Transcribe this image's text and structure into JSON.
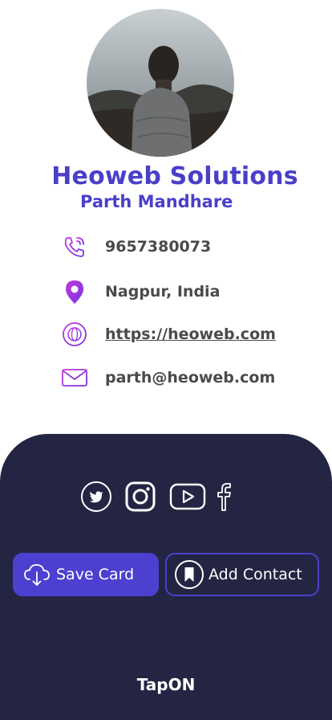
{
  "profile": {
    "company": "Heoweb Solutions",
    "name": "Parth Mandhare"
  },
  "contacts": {
    "phone": "9657380073",
    "location": "Nagpur, India",
    "website": "https://heoweb.com",
    "email": "parth@heoweb.com"
  },
  "icons": {
    "phone": "phone-icon",
    "location": "location-pin-icon",
    "website": "globe-icon",
    "email": "envelope-icon",
    "twitter": "twitter-icon",
    "instagram": "instagram-icon",
    "youtube": "youtube-icon",
    "facebook": "facebook-icon",
    "save": "cloud-download-icon",
    "add": "bookmark-icon"
  },
  "actions": {
    "save_label": "Save Card",
    "add_label": "Add Contact"
  },
  "footer": {
    "brand": "TapON"
  },
  "colors": {
    "accent": "#4a3fc9",
    "icon_gradient_start": "#c03ad8",
    "icon_gradient_end": "#7a32e6",
    "panel": "#232543",
    "text": "#4a4a4a"
  }
}
